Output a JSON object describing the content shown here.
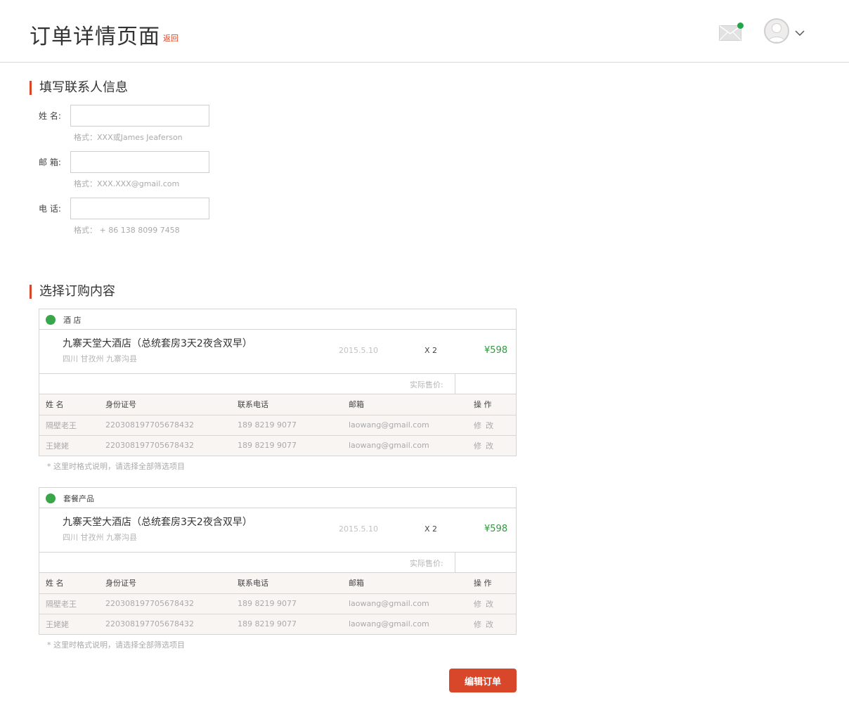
{
  "header": {
    "title": "订单详情页面",
    "back_label": "返回"
  },
  "contact": {
    "section_title": "填写联系人信息",
    "fields": [
      {
        "label": "姓  名:",
        "value": "",
        "hint": "格式：XXX或James Jeaferson"
      },
      {
        "label": "邮  箱:",
        "value": "",
        "hint": "格式：XXX.XXX@gmail.com"
      },
      {
        "label": "电  话:",
        "value": "",
        "hint": "格式： + 86 138 8099 7458"
      }
    ]
  },
  "order": {
    "section_title": "选择订购内容",
    "table_headers": {
      "name": "姓  名",
      "id": "身份证号",
      "phone": "联系电话",
      "email": "邮箱",
      "ops": "操 作"
    },
    "cards": [
      {
        "type": "酒  店",
        "product_name": "九寨天堂大酒店（总统套房3天2夜含双早）",
        "location": "四川 甘孜州 九寨沟县",
        "date": "2015.5.10",
        "qty": "X 2",
        "price": "¥598",
        "actual_label": "实际售价:",
        "guests": [
          {
            "name": "隔壁老王",
            "id": "220308197705678432",
            "phone": "189 8219 9077",
            "email": "laowang@gmail.com",
            "ops": "修改"
          },
          {
            "name": "王姥姥",
            "id": "220308197705678432",
            "phone": "189 8219 9077",
            "email": "laowang@gmail.com",
            "ops": "修改"
          }
        ],
        "note": "* 这里时格式说明，请选择全部筛选项目"
      },
      {
        "type": "套餐产品",
        "product_name": "九寨天堂大酒店（总统套房3天2夜含双早）",
        "location": "四川 甘孜州 九寨沟县",
        "date": "2015.5.10",
        "qty": "X 2",
        "price": "¥598",
        "actual_label": "实际售价:",
        "guests": [
          {
            "name": "隔壁老王",
            "id": "220308197705678432",
            "phone": "189 8219 9077",
            "email": "laowang@gmail.com",
            "ops": "修改"
          },
          {
            "name": "王姥姥",
            "id": "220308197705678432",
            "phone": "189 8219 9077",
            "email": "laowang@gmail.com",
            "ops": "修改"
          }
        ],
        "note": "* 这里时格式说明，请选择全部筛选项目"
      }
    ]
  },
  "actions": {
    "edit_label": "编辑订单"
  },
  "colors": {
    "accent": "#d8472a",
    "price_green": "#2e9b3e",
    "dot_green": "#3aa64a",
    "notify": "#1fa84a"
  },
  "icons": {
    "mail": "mail-icon",
    "avatar": "user-avatar-icon",
    "chevron": "chevron-down-icon"
  }
}
